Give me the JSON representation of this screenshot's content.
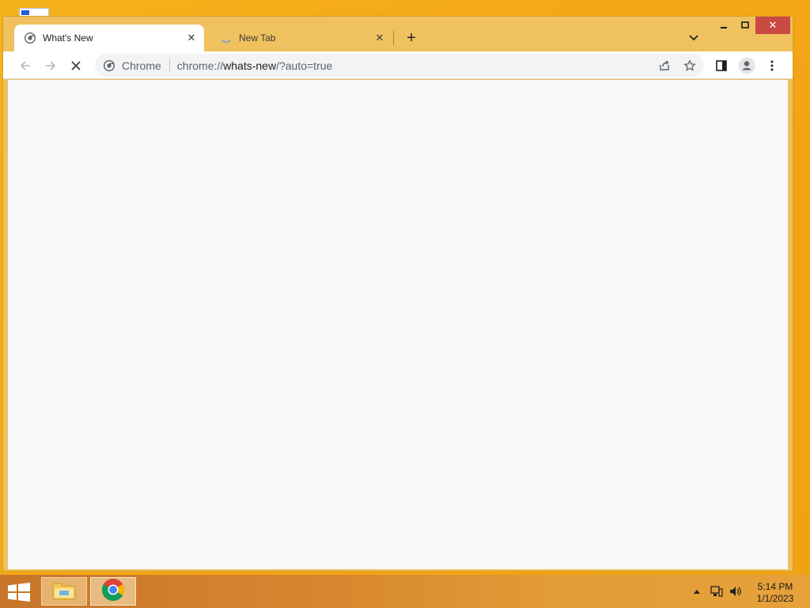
{
  "tabs": [
    {
      "title": "What's New",
      "active": true,
      "icon": "chrome-logo-icon"
    },
    {
      "title": "New Tab",
      "active": false,
      "icon": "loading-spinner-icon"
    }
  ],
  "omnibox": {
    "chip": "Chrome",
    "url_scheme": "chrome://",
    "url_host": "whats-new",
    "url_path": "/?auto=true"
  },
  "icons": {
    "back": "back-arrow-icon",
    "forward": "forward-arrow-icon",
    "stop": "stop-loading-icon",
    "share": "share-icon",
    "bookmark": "bookmark-star-icon",
    "side_panel": "side-panel-icon",
    "profile": "profile-avatar-icon",
    "menu": "three-dot-menu-icon"
  },
  "taskbar": {
    "apps": [
      "File Explorer",
      "Google Chrome"
    ],
    "clock_time": "5:14 PM",
    "clock_date": "1/1/2023"
  },
  "colors": {
    "tabstrip": "#efc15f",
    "page_bg": "#f8f9fa",
    "close_button": "#c94a43",
    "desktop": "#f3a516"
  }
}
